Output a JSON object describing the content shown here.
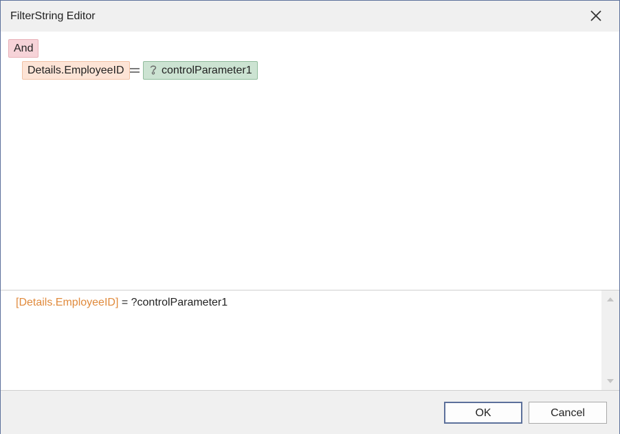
{
  "window": {
    "title": "FilterString Editor",
    "close_icon": "close-icon"
  },
  "editor": {
    "group_operator": "And",
    "condition": {
      "field": "Details.EmployeeID",
      "operator": "=",
      "value_icon": "parameter-icon",
      "value": "controlParameter1"
    }
  },
  "expression": {
    "field": "[Details.EmployeeID]",
    "rest": " = ?controlParameter1"
  },
  "buttons": {
    "ok": "OK",
    "cancel": "Cancel"
  },
  "colors": {
    "field_text": "#e08a3c",
    "group_chip": "#f6d3d8",
    "field_chip": "#fde4d6",
    "param_chip": "#cce3d2"
  }
}
